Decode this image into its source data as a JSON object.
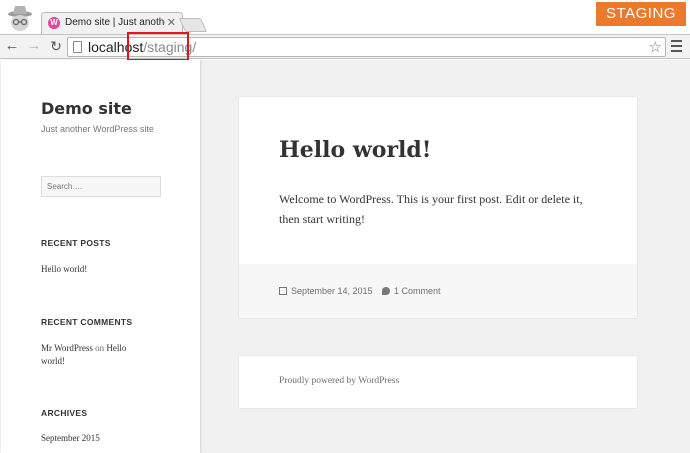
{
  "browser": {
    "tab_title": "Demo site | Just another W",
    "tab_favicon": "wordpress-icon",
    "url_host": "localhost",
    "url_path": "/staging/",
    "staging_badge": "STAGING",
    "accent_color": "#ec7a2c",
    "highlight_color": "#e5141b"
  },
  "sidebar": {
    "site_title": "Demo site",
    "site_description": "Just another WordPress site",
    "search_placeholder": "Search …",
    "recent_posts_title": "RECENT POSTS",
    "recent_posts": [
      "Hello world!"
    ],
    "recent_comments_title": "RECENT COMMENTS",
    "comment_author": "Mr WordPress",
    "comment_on": "on",
    "comment_post": "Hello world!",
    "archives_title": "ARCHIVES",
    "archives": [
      "September 2015"
    ]
  },
  "post": {
    "title": "Hello world!",
    "body": "Welcome to WordPress. This is your first post. Edit or delete it, then start writing!",
    "date": "September 14, 2015",
    "comments": "1 Comment"
  },
  "footer": {
    "powered_by": "Proudly powered by WordPress"
  }
}
